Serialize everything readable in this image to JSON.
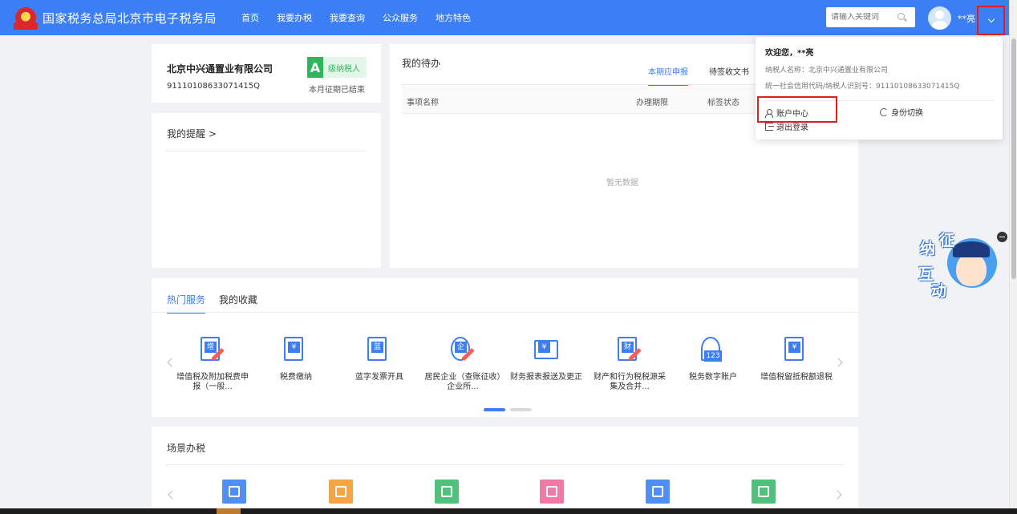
{
  "header": {
    "site_title": "国家税务总局北京市电子税务局",
    "nav": [
      "首页",
      "我要办税",
      "我要查询",
      "公众服务",
      "地方特色"
    ],
    "search_placeholder": "请输入关键词",
    "user_name": "**亮"
  },
  "company": {
    "name": "北京中兴通置业有限公司",
    "tax_id": "91110108633071415Q",
    "grade_letter": "A",
    "grade_text": "级纳税人",
    "period_status": "本月征期已结束"
  },
  "reminder": {
    "title": "我的提醒 >"
  },
  "todo": {
    "title": "我的待办",
    "tabs": [
      "本期应申报",
      "待签收文书"
    ],
    "columns": [
      "事项名称",
      "办理期限",
      "标签状态"
    ],
    "empty_text": "暂无数据"
  },
  "hot_services": {
    "tabs": [
      "热门服务",
      "我的收藏"
    ],
    "items": [
      {
        "label": "增值税及附加税费申报（一般...",
        "glyph": "增",
        "icon": "vat-declare-icon"
      },
      {
        "label": "税费缴纳",
        "glyph": "¥",
        "icon": "tax-payment-icon"
      },
      {
        "label": "蓝字发票开具",
        "glyph": "蓝",
        "icon": "invoice-printer-icon"
      },
      {
        "label": "居民企业（查账征收）企业所...",
        "glyph": "企",
        "icon": "enterprise-tax-icon"
      },
      {
        "label": "财务报表报送及更正",
        "glyph": "¥",
        "icon": "financial-report-icon"
      },
      {
        "label": "财产和行为税税源采集及合并...",
        "glyph": "财",
        "icon": "property-tax-icon"
      },
      {
        "label": "税务数字账户",
        "glyph": "123",
        "icon": "digital-account-icon"
      },
      {
        "label": "增值税留抵税额退税",
        "glyph": "¥",
        "icon": "vat-refund-icon"
      }
    ]
  },
  "scenario": {
    "title": "场景办税",
    "icon_colors": [
      "#4f8ef7",
      "#f5a545",
      "#4fc17a",
      "#f07aa5",
      "#4f8ef7",
      "#4fc17a"
    ]
  },
  "dropdown": {
    "welcome": "欢迎您，**亮",
    "taxpayer_name_line": "纳税人名称：北京中兴通置业有限公司",
    "credit_code_line": "统一社会信用代码/纳税人识别号：91110108633071415Q",
    "account_center": "账户中心",
    "switch_identity": "身份切换",
    "logout": "退出登录"
  },
  "mascot": {
    "chars": [
      "纳",
      "征",
      "互",
      "动"
    ]
  },
  "colors": {
    "primary": "#3c7ff4",
    "grade_green": "#2fb65c",
    "highlight_red": "#e02020"
  }
}
